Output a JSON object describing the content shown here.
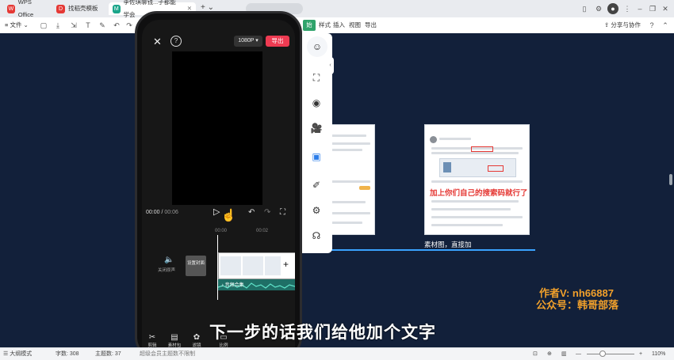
{
  "tabs": [
    {
      "label": "WPS Office",
      "icon": "wps-logo-icon",
      "color": "#e53935"
    },
    {
      "label": "找稻壳模板",
      "icon": "docer-icon",
      "color": "#e53935"
    },
    {
      "label": "李佐琪聊钱...子都能学会",
      "icon": "mindmap-icon",
      "color": "#1aa58a"
    }
  ],
  "toolbar": {
    "file_label": "文件",
    "menus": [
      "样式",
      "插入",
      "视图",
      "导出"
    ],
    "share_label": "分享与协作",
    "help_label": "?"
  },
  "phone": {
    "resolution_label": "1080P",
    "export_label": "导出",
    "time_current": "00:00",
    "time_total": "00:06",
    "ruler": [
      "00:00",
      "00:02"
    ],
    "audio_track_label": "关闭原声",
    "cover_label": "设置封面",
    "audio_clip_label": "音频合集",
    "tools": [
      {
        "label": "剪辑",
        "icon": "scissors-icon"
      },
      {
        "label": "素材包",
        "icon": "package-icon"
      },
      {
        "label": "滤镜",
        "icon": "filter-icon"
      },
      {
        "label": "比例",
        "icon": "ratio-icon"
      }
    ]
  },
  "canvas": {
    "card2_highlight_text": "加上你们自己的搜索码就行了",
    "node_label": "素材图，直接加",
    "watermark_line1": "作者V: nh66887",
    "watermark_line2": "公众号：韩哥部落",
    "subtitle": "下一步的话我们给他加个文字"
  },
  "status": {
    "outline_mode": "大纲模式",
    "word_count": "字数: 308",
    "topic_count": "主题数: 37",
    "limit_note": "超级会员主题数不限制",
    "zoom": "110%"
  },
  "colors": {
    "accent_red": "#ee3b52",
    "canvas_bg": "#12203a",
    "connector_blue": "#3aa3ff",
    "watermark_orange": "#f1a02b"
  }
}
